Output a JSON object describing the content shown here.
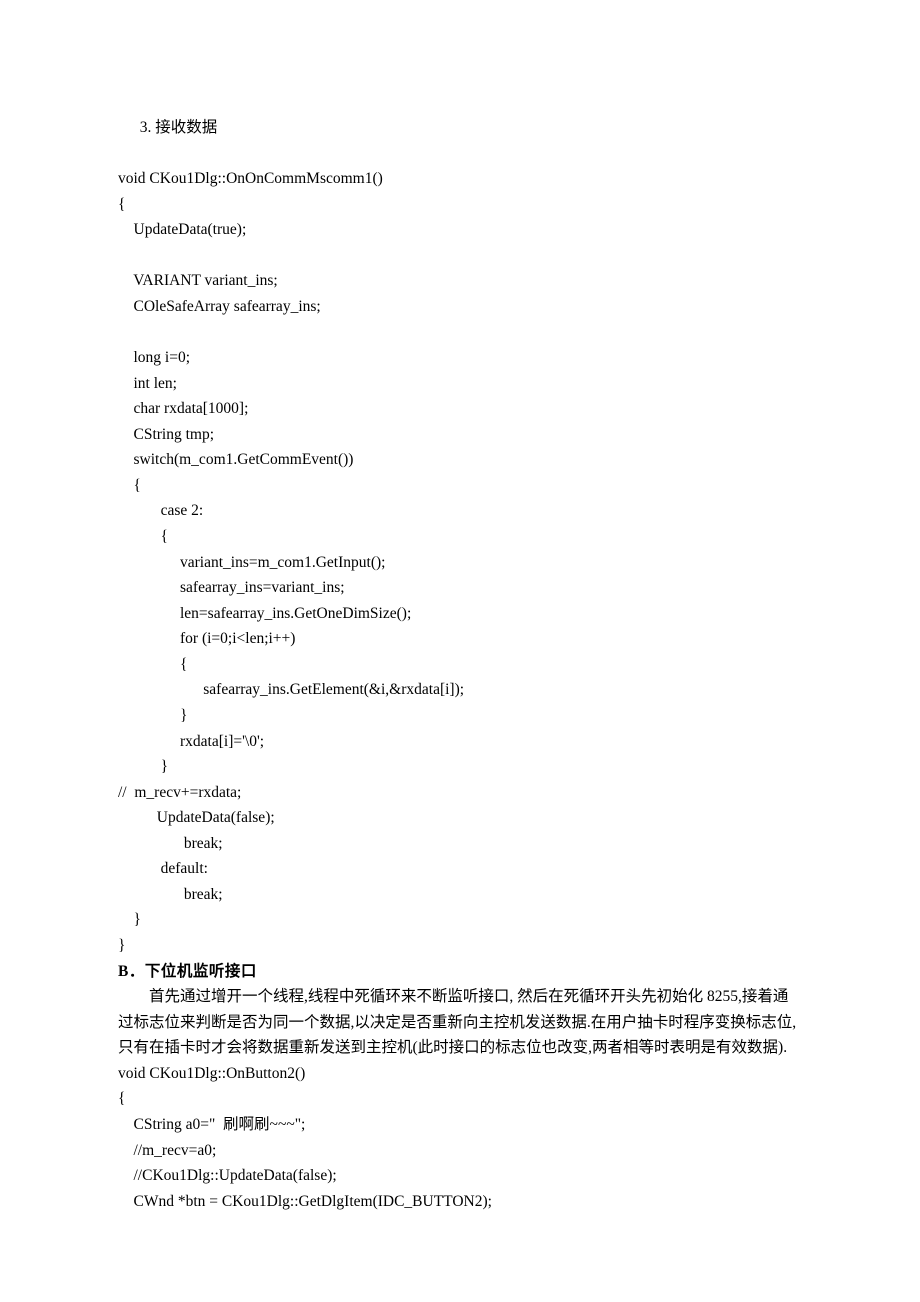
{
  "section_a": {
    "item_label": "3.  接收数据",
    "code": "void CKou1Dlg::OnOnCommMscomm1()\n{\n    UpdateData(true);\n\n    VARIANT variant_ins;\n    COleSafeArray safearray_ins;\n\n    long i=0;\n    int len;\n    char rxdata[1000];\n    CString tmp;\n    switch(m_com1.GetCommEvent())\n    {\n           case 2:\n           {\n                variant_ins=m_com1.GetInput();\n                safearray_ins=variant_ins;\n                len=safearray_ins.GetOneDimSize();\n                for (i=0;i<len;i++)\n                {\n                      safearray_ins.GetElement(&i,&rxdata[i]);\n                }\n                rxdata[i]='\\0';\n           }\n//  m_recv+=rxdata;\n          UpdateData(false);\n                 break;\n           default:\n                 break;\n    }\n}"
  },
  "section_b": {
    "title": "B．下位机监听接口",
    "paragraph": "首先通过增开一个线程,线程中死循环来不断监听接口,  然后在死循环开头先初始化 8255,接着通过标志位来判断是否为同一个数据,以决定是否重新向主控机发送数据.在用户抽卡时程序变换标志位,只有在插卡时才会将数据重新发送到主控机(此时接口的标志位也改变,两者相等时表明是有效数据).",
    "code": "void CKou1Dlg::OnButton2()\n{\n    CString a0=\"  刷啊刷~~~\";\n    //m_recv=a0;\n    //CKou1Dlg::UpdateData(false);\n    CWnd *btn = CKou1Dlg::GetDlgItem(IDC_BUTTON2);"
  }
}
